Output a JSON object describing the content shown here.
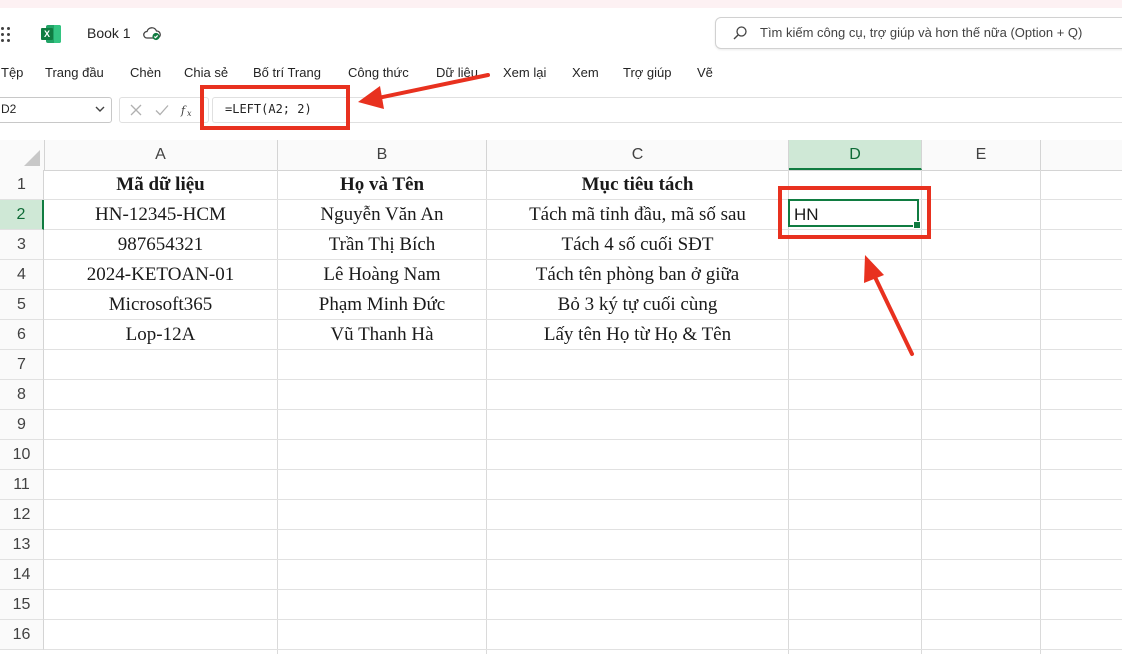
{
  "app": {
    "title": "Book 1",
    "search_placeholder": "Tìm kiếm công cụ, trợ giúp và hơn thế nữa (Option + Q)"
  },
  "menu": [
    "Tệp",
    "Trang đầu",
    "Chèn",
    "Chia sẻ",
    "Bố trí Trang",
    "Công thức",
    "Dữ liệu",
    "Xem lại",
    "Xem",
    "Trợ giúp",
    "Vẽ"
  ],
  "formula_bar": {
    "name_box": "D2",
    "formula": "=LEFT(A2; 2)"
  },
  "columns": [
    "A",
    "B",
    "C",
    "D",
    "E"
  ],
  "active_column": "D",
  "rows": [
    "1",
    "2",
    "3",
    "4",
    "5",
    "6",
    "7",
    "8",
    "9",
    "10",
    "11",
    "12",
    "13",
    "14",
    "15",
    "16"
  ],
  "active_row": "2",
  "table": {
    "headers": [
      "Mã dữ liệu",
      "Họ và Tên",
      "Mục tiêu tách"
    ],
    "data": [
      [
        "HN-12345-HCM",
        "Nguyễn Văn An",
        "Tách mã tỉnh đầu, mã số sau"
      ],
      [
        "987654321",
        "Trần Thị Bích",
        "Tách 4 số cuối SĐT"
      ],
      [
        "2024-KETOAN-01",
        "Lê Hoàng Nam",
        "Tách tên phòng ban ở giữa"
      ],
      [
        "Microsoft365",
        "Phạm Minh Đức",
        "Bỏ 3 ký tự cuối cùng"
      ],
      [
        "Lop-12A",
        "Vũ Thanh Hà",
        "Lấy tên Họ từ Họ & Tên"
      ]
    ]
  },
  "active_cell": {
    "ref": "D2",
    "value": "HN"
  },
  "colors": {
    "accent_green": "#107c41",
    "highlight_red": "#e8311f"
  },
  "icons": [
    "app-launcher-icon",
    "excel-logo-icon",
    "cloud-sync-icon",
    "search-icon",
    "chevron-down-icon",
    "cancel-x-icon",
    "check-icon",
    "fx-icon"
  ]
}
